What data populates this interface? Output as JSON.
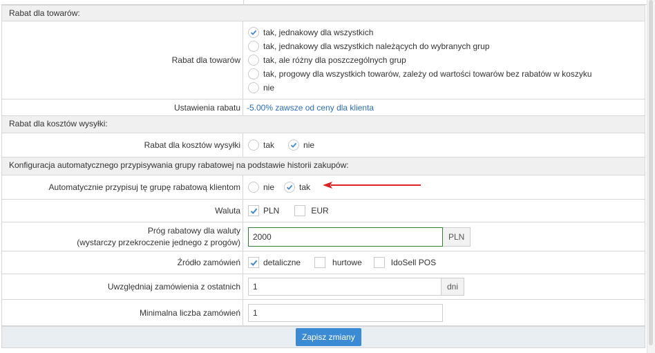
{
  "sections": {
    "discount_products": "Rabat dla towarów:",
    "discount_shipping": "Rabat dla kosztów wysyłki:",
    "auto_assign": "Konfiguracja automatycznego przypisywania grupy rabatowej na podstawie historii zakupów:"
  },
  "discount_products": {
    "label": "Rabat dla towarów",
    "options": [
      {
        "label": "tak, jednakowy dla wszystkich",
        "checked": true
      },
      {
        "label": "tak, jednakowy dla wszystkich należących do wybranych grup",
        "checked": false
      },
      {
        "label": "tak, ale różny dla poszczególnych grup",
        "checked": false
      },
      {
        "label": "tak, progowy dla wszystkich towarów, zależy od wartości towarów bez rabatów w koszyku",
        "checked": false
      },
      {
        "label": "nie",
        "checked": false
      }
    ]
  },
  "discount_settings": {
    "label": "Ustawienia rabatu",
    "value": "-5.00% zawsze od ceny dla klienta"
  },
  "shipping": {
    "label": "Rabat dla kosztów wysyłki",
    "options": [
      {
        "label": "tak",
        "checked": false
      },
      {
        "label": "nie",
        "checked": true
      }
    ]
  },
  "auto": {
    "label": "Automatycznie przypisuj tę grupę rabatową klientom",
    "options": [
      {
        "label": "nie",
        "checked": false
      },
      {
        "label": "tak",
        "checked": true
      }
    ]
  },
  "currency": {
    "label": "Waluta",
    "options": [
      {
        "label": "PLN",
        "checked": true
      },
      {
        "label": "EUR",
        "checked": false
      }
    ]
  },
  "threshold": {
    "label1": "Próg rabatowy dla waluty",
    "label2": "(wystarczy przekroczenie jednego z progów)",
    "value": "2000",
    "unit": "PLN"
  },
  "source": {
    "label": "Źródło zamówień",
    "options": [
      {
        "label": "detaliczne",
        "checked": true
      },
      {
        "label": "hurtowe",
        "checked": false
      },
      {
        "label": "IdoSell POS",
        "checked": false
      }
    ]
  },
  "recent": {
    "label": "Uwzględniaj zamówienia z ostatnich",
    "value": "1",
    "unit": "dni"
  },
  "min_orders": {
    "label": "Minimalna liczba zamówień",
    "value": "1"
  },
  "save_label": "Zapisz zmiany",
  "colors": {
    "accent": "#3b8bd4",
    "arrow": "#e02020",
    "focus_border": "#2e7d32"
  }
}
